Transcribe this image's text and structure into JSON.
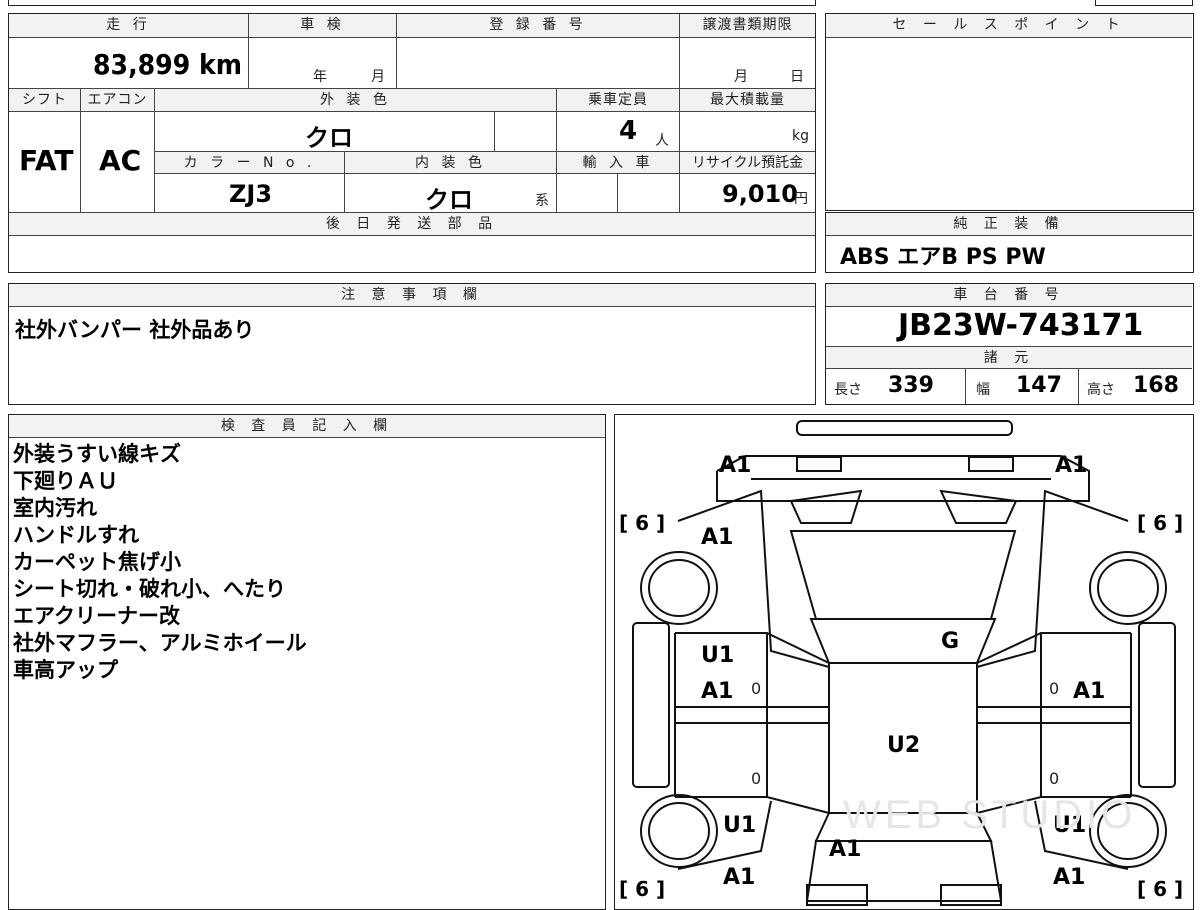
{
  "mileage": {
    "label": "走 行",
    "value": "83,899 km"
  },
  "inspection": {
    "label": "車 検",
    "year_unit": "年",
    "month_unit": "月"
  },
  "registration": {
    "label": "登 録 番 号"
  },
  "transfer_deadline": {
    "label": "譲渡書類期限",
    "month_unit": "月",
    "day_unit": "日"
  },
  "shift": {
    "label": "シフト",
    "value": "FAT"
  },
  "aircon": {
    "label": "エアコン",
    "value": "AC"
  },
  "exterior_color": {
    "label": "外 装 色",
    "value": "クロ"
  },
  "capacity": {
    "label": "乗車定員",
    "value": "4",
    "unit": "人"
  },
  "max_load": {
    "label": "最大積載量",
    "unit": "kg"
  },
  "color_no": {
    "label": "カ ラ ー N o .",
    "value": "ZJ3"
  },
  "interior_color": {
    "label": "内 装 色",
    "value": "クロ",
    "suffix": "系"
  },
  "import": {
    "label": "輸 入 車"
  },
  "recycle": {
    "label": "リサイクル預託金",
    "value": "9,010",
    "unit": "円"
  },
  "later_parts": {
    "label": "後 日 発 送 部 品"
  },
  "sales_point": {
    "label": "セ ー ル ス ポ イ ン ト"
  },
  "genuine_equipment": {
    "label": "純 正 装 備",
    "value": "ABS エアB PS PW"
  },
  "caution": {
    "label": "注 意 事 項 欄",
    "value": "社外バンパー 社外品あり"
  },
  "chassis": {
    "label": "車 台 番 号",
    "value": "JB23W-743171"
  },
  "specs": {
    "label": "諸 元",
    "length_label": "長さ",
    "length": "339",
    "width_label": "幅",
    "width": "147",
    "height_label": "高さ",
    "height": "168"
  },
  "inspector": {
    "label": "検 査 員 記 入 欄",
    "items": [
      "外装うすい線キズ",
      "下廻りＡＵ",
      "室内汚れ",
      "ハンドルすれ",
      "カーペット焦げ小",
      "シート切れ・破れ小、へたり",
      "エアクリーナー改",
      "社外マフラー、アルミホイール",
      "車高アップ"
    ]
  },
  "diagram": {
    "front_left": "A1",
    "front_right": "A1",
    "fender_left": "A1",
    "tire_fl": "[ 6 ]",
    "tire_fr": "[ 6 ]",
    "tire_rl": "[ 6 ]",
    "tire_rr": "[ 6 ]",
    "windshield": "G",
    "door_fl_1": "U1",
    "door_fl_2": "A1",
    "door_fl_mark": "0",
    "door_fr_mark": "0",
    "door_fr": "A1",
    "roof": "U2",
    "door_rl_mark": "0",
    "door_rr_mark": "0",
    "rear_left_1": "U1",
    "rear_right_1": "U1",
    "rear_center": "A1",
    "rear_left_2": "A1",
    "rear_right_2": "A1",
    "watermark": "WEB STUDIO"
  }
}
